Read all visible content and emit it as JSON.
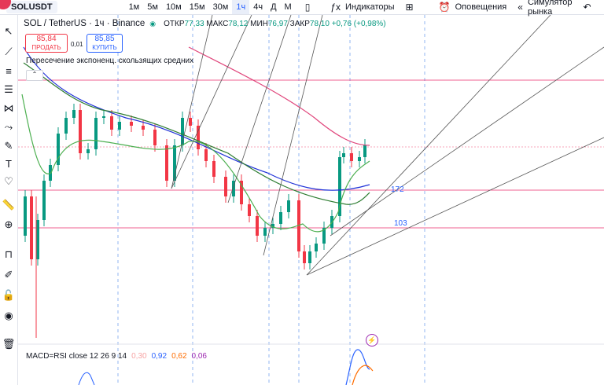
{
  "toolbar": {
    "symbol": "SOLUSDT",
    "timeframes": [
      "1м",
      "5м",
      "10м",
      "15м",
      "30м",
      "1ч",
      "4ч",
      "Д",
      "М"
    ],
    "active_timeframe": "1ч",
    "indicators_label": "Индикаторы",
    "alerts_label": "Оповещения",
    "replay_label": "Симулятор рынка"
  },
  "legend": {
    "symbol_line": "SOL / TetherUS · 1ч · Binance",
    "open_label": "ОТКР",
    "open_value": "77,33",
    "high_label": "МАКС",
    "high_value": "78,12",
    "low_label": "МИН",
    "low_value": "76,97",
    "close_label": "ЗАКР",
    "close_value": "78,10",
    "change": "+0,76 (+0,98%)"
  },
  "trade": {
    "sell_price": "85,84",
    "sell_label": "ПРОДАТЬ",
    "spread": "0,01",
    "buy_price": "85,85",
    "buy_label": "КУПИТЬ"
  },
  "study_label": "Пересечение экспоненц. скользящих средних",
  "levels": {
    "upper": "172",
    "lower": "103"
  },
  "macd": {
    "label": "MACD=RSI close 12 26 9 14",
    "v1": "0,30",
    "v2": "0,92",
    "v3": "0,62",
    "v4": "0,06",
    "c1": "#f7a4a4",
    "c2": "#2962ff",
    "c3": "#ff6d00",
    "c4": "#9c27b0"
  },
  "colors": {
    "up": "#089981",
    "down": "#f23645",
    "hline": "#e91e63",
    "ma_blue": "#2133d8",
    "ma_green": "#2e7d32",
    "ma_lightgreen": "#4caf50",
    "ma_pink": "#e0457b"
  }
}
